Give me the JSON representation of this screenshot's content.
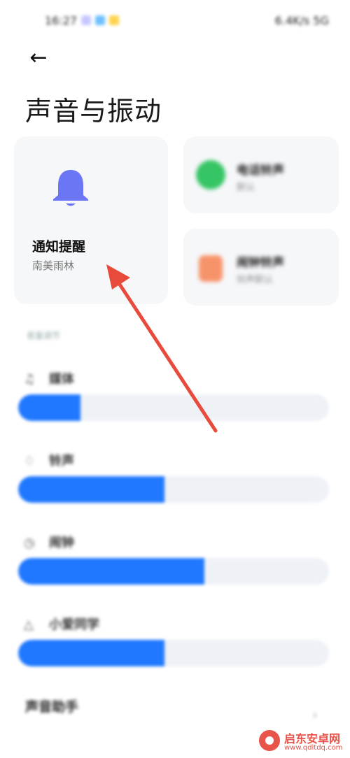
{
  "status_bar": {
    "time": "16:27",
    "right": "6.4K/s 5G"
  },
  "header": {
    "back_icon": "arrow-left-icon",
    "title": "声音与振动"
  },
  "cards": {
    "notification": {
      "icon": "bell-icon",
      "title": "通知提醒",
      "subtitle": "南美雨林",
      "icon_color": "#6b76f5"
    },
    "phone_ringtone": {
      "icon": "phone-icon",
      "title": "电话铃声",
      "subtitle": "默认"
    },
    "alarm_ringtone": {
      "icon": "clock-icon",
      "title": "闹钟铃声",
      "subtitle": "铃声默认"
    }
  },
  "volume": {
    "section_label": "音量调节",
    "sliders": [
      {
        "label": "媒体",
        "icon": "music-note-icon",
        "level": 0.2
      },
      {
        "label": "铃声",
        "icon": "bell-outline-icon",
        "level": 0.47
      },
      {
        "label": "闹钟",
        "icon": "alarm-icon",
        "level": 0.6
      },
      {
        "label": "小爱同学",
        "icon": "assistant-icon",
        "level": 0.47
      }
    ]
  },
  "assistant": {
    "title": "声音助手",
    "description": ""
  },
  "annotation": {
    "color": "#e84a3c"
  },
  "watermark": {
    "name": "启东安卓网",
    "url": "www.qdltdq.com"
  },
  "colors": {
    "accent": "#1f78ff",
    "track": "#eef1f6"
  }
}
